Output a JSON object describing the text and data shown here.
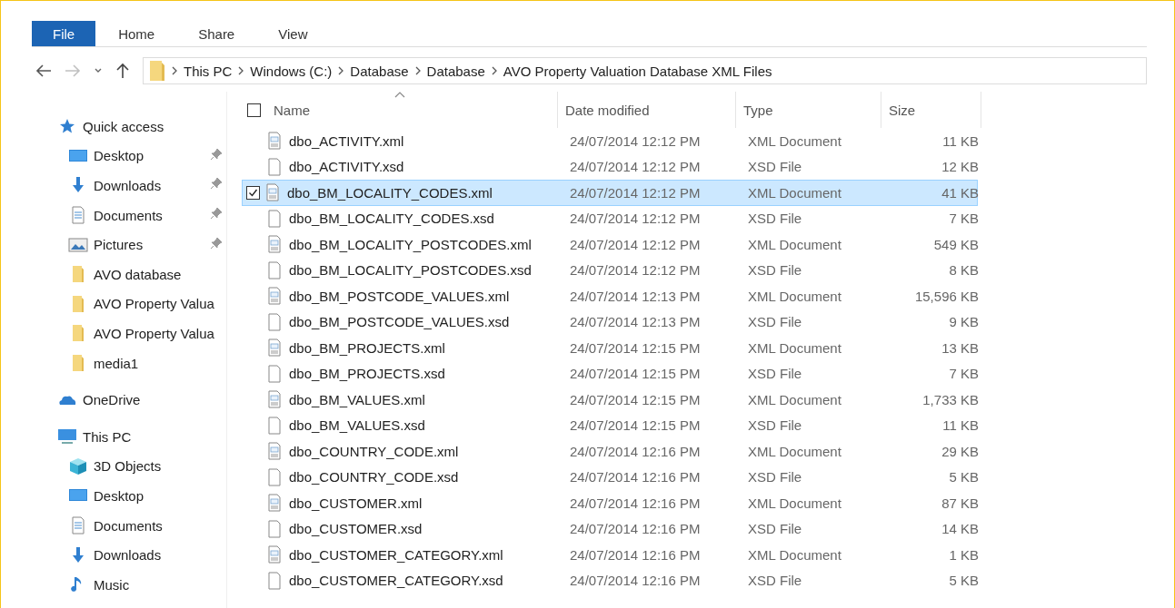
{
  "ribbon": {
    "tabs": [
      {
        "label": "File",
        "selected": true
      },
      {
        "label": "Home",
        "selected": false
      },
      {
        "label": "Share",
        "selected": false
      },
      {
        "label": "View",
        "selected": false
      }
    ]
  },
  "address": {
    "back_disabled": false,
    "forward_disabled": true,
    "path": [
      "This PC",
      "Windows (C:)",
      "Database",
      "Database",
      "AVO Property Valuation Database XML Files"
    ]
  },
  "sidebar": {
    "sections": [
      {
        "label": "Quick access",
        "kind": "star",
        "children": [
          {
            "label": "Desktop",
            "kind": "desktop",
            "pinned": true
          },
          {
            "label": "Downloads",
            "kind": "download",
            "pinned": true
          },
          {
            "label": "Documents",
            "kind": "document",
            "pinned": true
          },
          {
            "label": "Pictures",
            "kind": "pictures",
            "pinned": true
          },
          {
            "label": "AVO database",
            "kind": "folder",
            "pinned": false
          },
          {
            "label": "AVO Property Valua",
            "kind": "folder",
            "pinned": false
          },
          {
            "label": "AVO Property Valua",
            "kind": "folder",
            "pinned": false
          },
          {
            "label": "media1",
            "kind": "folder",
            "pinned": false
          }
        ]
      },
      {
        "label": "OneDrive",
        "kind": "cloud"
      },
      {
        "label": "This PC",
        "kind": "pc",
        "children": [
          {
            "label": "3D Objects",
            "kind": "cube",
            "pinned": false
          },
          {
            "label": "Desktop",
            "kind": "desktop",
            "pinned": false
          },
          {
            "label": "Documents",
            "kind": "document",
            "pinned": false
          },
          {
            "label": "Downloads",
            "kind": "download",
            "pinned": false
          },
          {
            "label": "Music",
            "kind": "music",
            "pinned": false
          }
        ]
      }
    ]
  },
  "table": {
    "select_all_checked": false,
    "sorted_by_name": true,
    "columns": [
      "Name",
      "Date modified",
      "Type",
      "Size"
    ],
    "rows": [
      {
        "kind": "xml",
        "name": "dbo_ACTIVITY.xml",
        "date": "24/07/2014 12:12 PM",
        "type": "XML Document",
        "size": "11 KB",
        "selected": false
      },
      {
        "kind": "xsd",
        "name": "dbo_ACTIVITY.xsd",
        "date": "24/07/2014 12:12 PM",
        "type": "XSD File",
        "size": "12 KB",
        "selected": false
      },
      {
        "kind": "xml",
        "name": "dbo_BM_LOCALITY_CODES.xml",
        "date": "24/07/2014 12:12 PM",
        "type": "XML Document",
        "size": "41 KB",
        "selected": true
      },
      {
        "kind": "xsd",
        "name": "dbo_BM_LOCALITY_CODES.xsd",
        "date": "24/07/2014 12:12 PM",
        "type": "XSD File",
        "size": "7 KB",
        "selected": false
      },
      {
        "kind": "xml",
        "name": "dbo_BM_LOCALITY_POSTCODES.xml",
        "date": "24/07/2014 12:12 PM",
        "type": "XML Document",
        "size": "549 KB",
        "selected": false
      },
      {
        "kind": "xsd",
        "name": "dbo_BM_LOCALITY_POSTCODES.xsd",
        "date": "24/07/2014 12:12 PM",
        "type": "XSD File",
        "size": "8 KB",
        "selected": false
      },
      {
        "kind": "xml",
        "name": "dbo_BM_POSTCODE_VALUES.xml",
        "date": "24/07/2014 12:13 PM",
        "type": "XML Document",
        "size": "15,596 KB",
        "selected": false
      },
      {
        "kind": "xsd",
        "name": "dbo_BM_POSTCODE_VALUES.xsd",
        "date": "24/07/2014 12:13 PM",
        "type": "XSD File",
        "size": "9 KB",
        "selected": false
      },
      {
        "kind": "xml",
        "name": "dbo_BM_PROJECTS.xml",
        "date": "24/07/2014 12:15 PM",
        "type": "XML Document",
        "size": "13 KB",
        "selected": false
      },
      {
        "kind": "xsd",
        "name": "dbo_BM_PROJECTS.xsd",
        "date": "24/07/2014 12:15 PM",
        "type": "XSD File",
        "size": "7 KB",
        "selected": false
      },
      {
        "kind": "xml",
        "name": "dbo_BM_VALUES.xml",
        "date": "24/07/2014 12:15 PM",
        "type": "XML Document",
        "size": "1,733 KB",
        "selected": false
      },
      {
        "kind": "xsd",
        "name": "dbo_BM_VALUES.xsd",
        "date": "24/07/2014 12:15 PM",
        "type": "XSD File",
        "size": "11 KB",
        "selected": false
      },
      {
        "kind": "xml",
        "name": "dbo_COUNTRY_CODE.xml",
        "date": "24/07/2014 12:16 PM",
        "type": "XML Document",
        "size": "29 KB",
        "selected": false
      },
      {
        "kind": "xsd",
        "name": "dbo_COUNTRY_CODE.xsd",
        "date": "24/07/2014 12:16 PM",
        "type": "XSD File",
        "size": "5 KB",
        "selected": false
      },
      {
        "kind": "xml",
        "name": "dbo_CUSTOMER.xml",
        "date": "24/07/2014 12:16 PM",
        "type": "XML Document",
        "size": "87 KB",
        "selected": false
      },
      {
        "kind": "xsd",
        "name": "dbo_CUSTOMER.xsd",
        "date": "24/07/2014 12:16 PM",
        "type": "XSD File",
        "size": "14 KB",
        "selected": false
      },
      {
        "kind": "xml",
        "name": "dbo_CUSTOMER_CATEGORY.xml",
        "date": "24/07/2014 12:16 PM",
        "type": "XML Document",
        "size": "1 KB",
        "selected": false
      },
      {
        "kind": "xsd",
        "name": "dbo_CUSTOMER_CATEGORY.xsd",
        "date": "24/07/2014 12:16 PM",
        "type": "XSD File",
        "size": "5 KB",
        "selected": false
      }
    ]
  }
}
